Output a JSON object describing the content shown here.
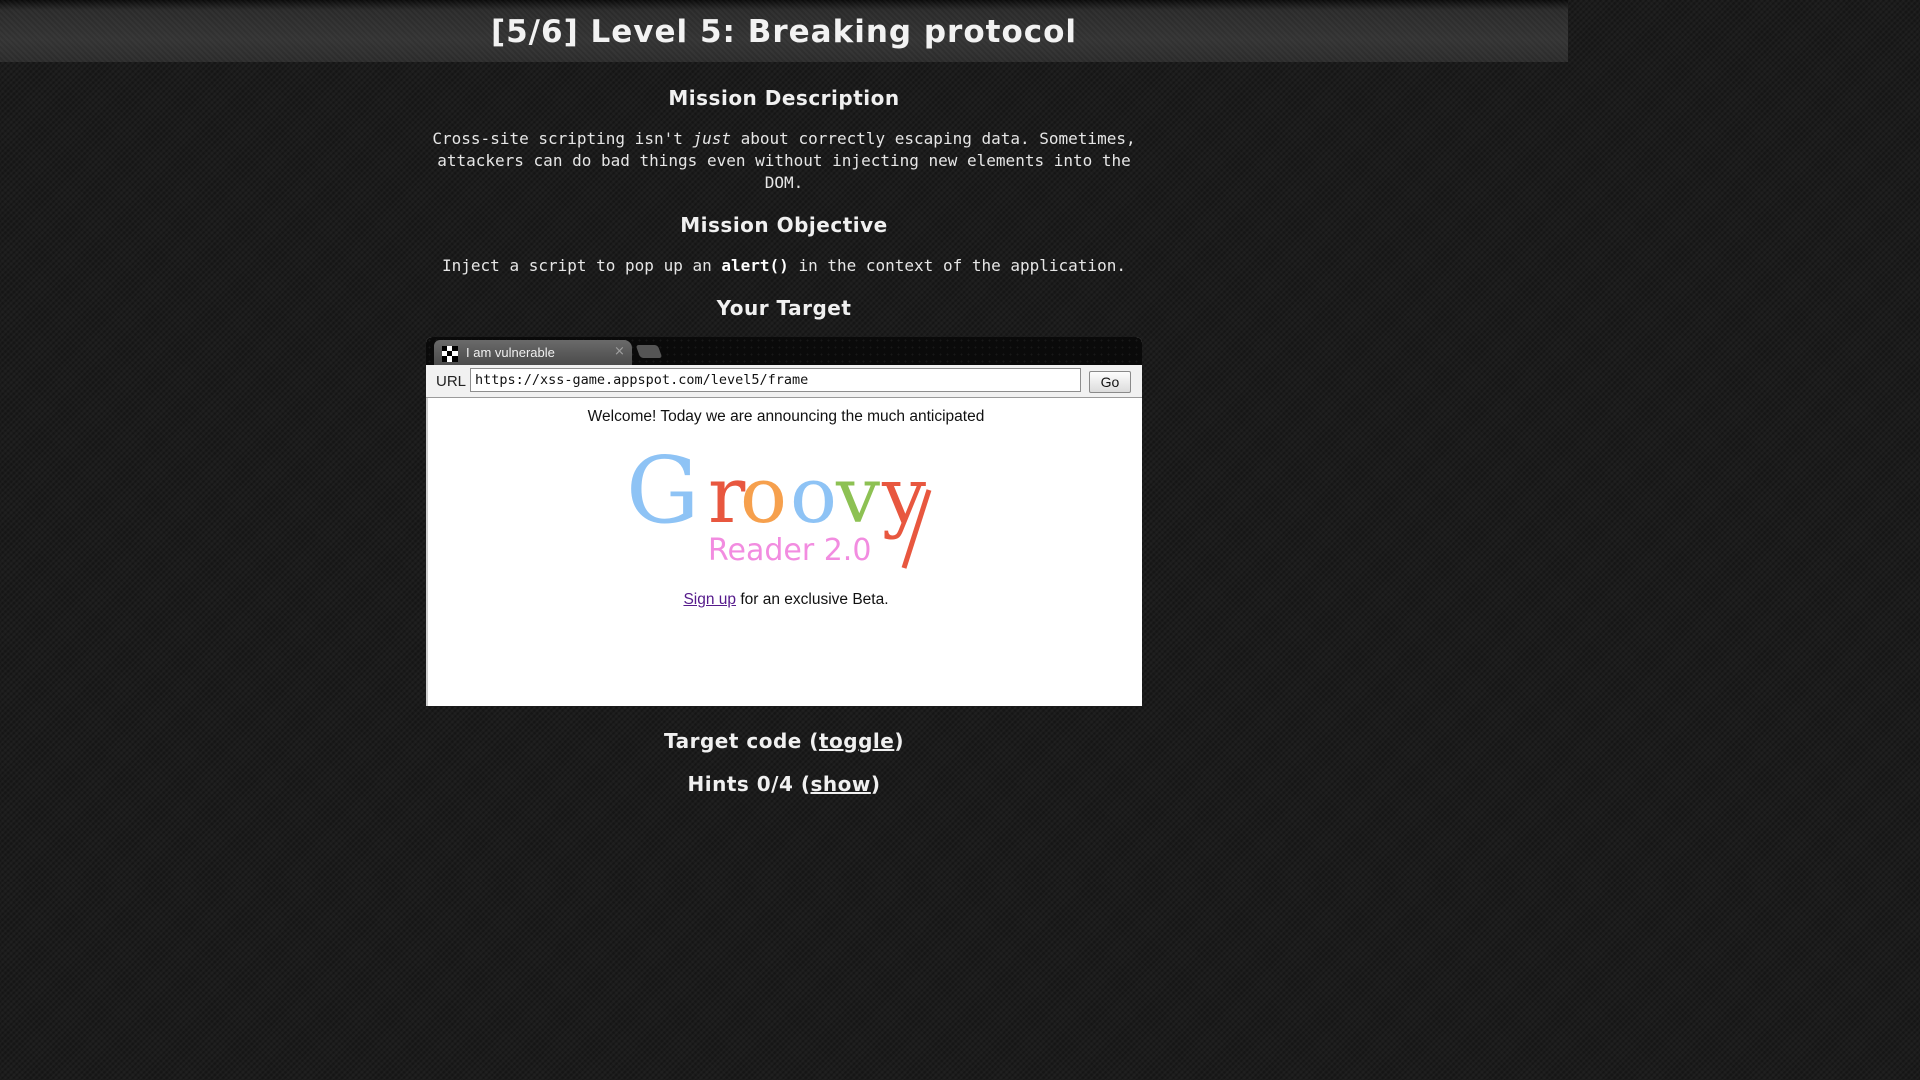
{
  "header": {
    "title": "[5/6]  Level 5: Breaking protocol"
  },
  "mission": {
    "description_heading": "Mission Description",
    "description_text_1": "Cross-site scripting isn't ",
    "description_text_em": "just",
    "description_text_2": " about correctly escaping data. Sometimes, attackers can do bad things even without injecting new elements into the DOM.",
    "objective_heading": "Mission Objective",
    "objective_text_1": "Inject a script to pop up an ",
    "objective_text_code": "alert()",
    "objective_text_2": " in the context of the application.",
    "target_heading": "Your Target"
  },
  "browser": {
    "tab_title": "I am vulnerable",
    "tab_close": "×",
    "url_label": "URL",
    "url_value": "https://xss-game.appspot.com/level5/frame",
    "go_label": "Go"
  },
  "frame": {
    "welcome_text": "Welcome! Today we are announcing the much anticipated",
    "logo_title": "Groovy",
    "logo_subtitle": "Reader 2.0",
    "signup_link": "Sign up",
    "signup_rest": " for an exclusive Beta."
  },
  "footer": {
    "target_code_prefix": "Target code (",
    "toggle_label": "toggle",
    "target_code_suffix": ")",
    "hints_prefix": "Hints 0/4 (",
    "show_label": "show",
    "hints_suffix": ")"
  },
  "colors": {
    "background": "#1c1c1c",
    "link_visited": "#551a8b",
    "logo_g": "#8ec3f5",
    "logo_r": "#e8573f",
    "logo_o1": "#f6a04d",
    "logo_o2": "#8ec3f5",
    "logo_v": "#8dc153",
    "logo_y": "#e8573f",
    "logo_subtitle": "#f28ce0"
  }
}
